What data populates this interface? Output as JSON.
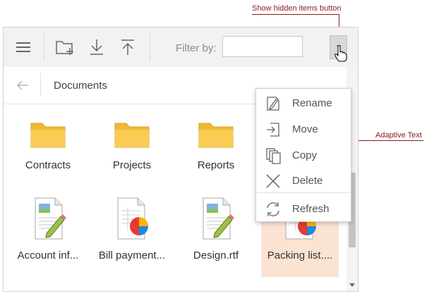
{
  "annotations": {
    "hidden_items": "Show hidden items button",
    "adaptive_text": "Adaptive Text"
  },
  "toolbar": {
    "menu_icon": "hamburger-icon",
    "new_folder_icon": "new-folder-icon",
    "download_icon": "download-icon",
    "upload_icon": "upload-icon",
    "filter_label": "Filter by:",
    "filter_value": "",
    "more_label": "..."
  },
  "breadcrumb": {
    "back_icon": "arrow-left-icon",
    "path": "Documents"
  },
  "items": [
    {
      "label": "Contracts",
      "icon": "folder-icon"
    },
    {
      "label": "Projects",
      "icon": "folder-icon"
    },
    {
      "label": "Reports",
      "icon": "folder-icon"
    },
    {
      "label": "Account inf...",
      "icon": "document-edit-icon"
    },
    {
      "label": "Bill payment...",
      "icon": "spreadsheet-chart-icon"
    },
    {
      "label": "Design.rtf",
      "icon": "document-edit-icon"
    },
    {
      "label": "Packing list....",
      "icon": "spreadsheet-chart-icon",
      "selected": true
    }
  ],
  "context_menu": [
    {
      "label": "Rename",
      "icon": "rename-icon"
    },
    {
      "label": "Move",
      "icon": "move-icon"
    },
    {
      "label": "Copy",
      "icon": "copy-icon"
    },
    {
      "label": "Delete",
      "icon": "delete-icon"
    },
    {
      "label": "Refresh",
      "icon": "refresh-icon"
    }
  ],
  "colors": {
    "annotation": "#8b1a1a",
    "selected_item": "#fbe3d4",
    "folder": "#f7c948"
  }
}
